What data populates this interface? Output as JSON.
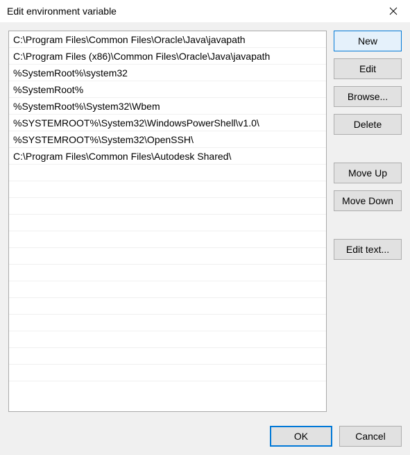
{
  "dialog": {
    "title": "Edit environment variable"
  },
  "list": {
    "items": [
      "C:\\Program Files\\Common Files\\Oracle\\Java\\javapath",
      "C:\\Program Files (x86)\\Common Files\\Oracle\\Java\\javapath",
      "%SystemRoot%\\system32",
      "%SystemRoot%",
      "%SystemRoot%\\System32\\Wbem",
      "%SYSTEMROOT%\\System32\\WindowsPowerShell\\v1.0\\",
      "%SYSTEMROOT%\\System32\\OpenSSH\\",
      "C:\\Program Files\\Common Files\\Autodesk Shared\\"
    ]
  },
  "buttons": {
    "new": "New",
    "edit": "Edit",
    "browse": "Browse...",
    "delete": "Delete",
    "moveUp": "Move Up",
    "moveDown": "Move Down",
    "editText": "Edit text...",
    "ok": "OK",
    "cancel": "Cancel"
  }
}
